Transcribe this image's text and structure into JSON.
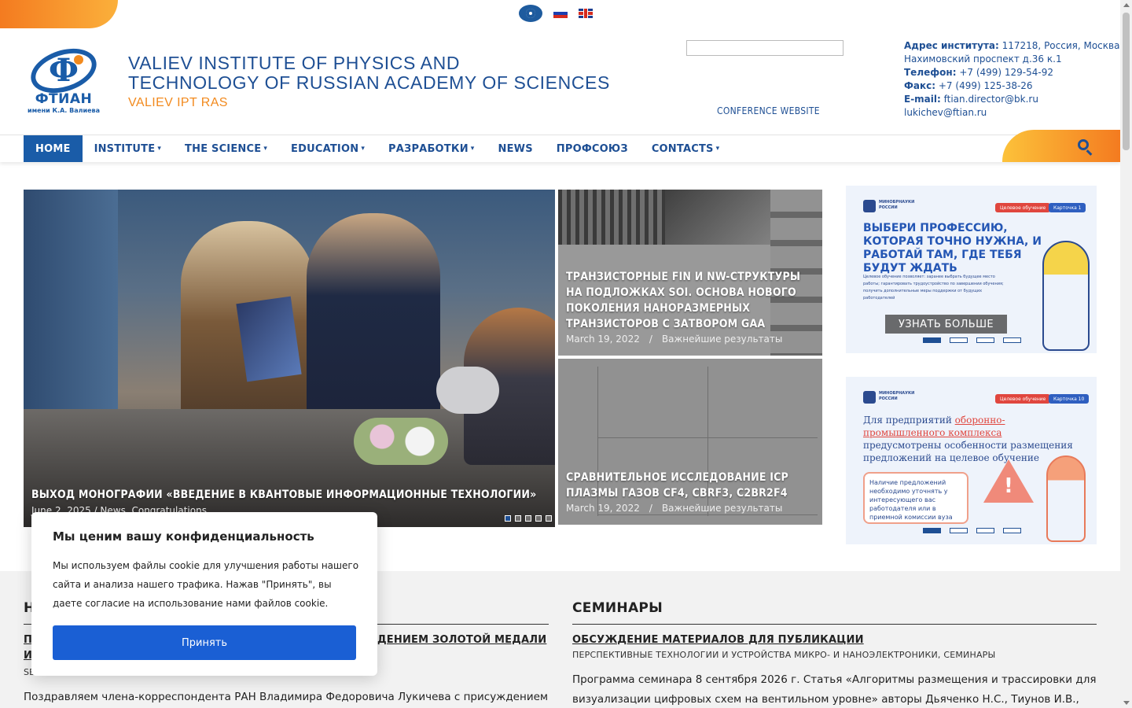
{
  "header": {
    "title_line1": "VALIEV INSTITUTE OF PHYSICS AND",
    "title_line2": "TECHNOLOGY OF RUSSIAN ACADEMY OF SCIENCES",
    "short_title": "VALIEV IPT RAS",
    "logo_name": "ФТИАН",
    "logo_sub": "имени К.А. Валиева",
    "conference_link": "CONFERENCE WEBSITE"
  },
  "contacts": {
    "address_label": "Адрес института:",
    "address_value": " 117218, Россия, Москва,",
    "address_line2": "Нахимовский проспект д.36 к.1",
    "phone_label": "Телефон:",
    "phone_value": " +7 (499) 129-54-92",
    "fax_label": "Факс:",
    "fax_value": " +7 (499) 125-38-26",
    "email_label": "E-mail:",
    "email_value": " ftian.director@bk.ru",
    "email_value2": "lukichev@ftian.ru"
  },
  "nav": [
    {
      "label": "HOME"
    },
    {
      "label": "INSTITUTE"
    },
    {
      "label": "THE SCIENCE"
    },
    {
      "label": "EDUCATION"
    },
    {
      "label": "РАЗРАБОТКИ"
    },
    {
      "label": "NEWS"
    },
    {
      "label": "ПРОФСОЮЗ"
    },
    {
      "label": "CONTACTS"
    }
  ],
  "hero": {
    "main_caption": "ВЫХОД МОНОГРАФИИ «ВВЕДЕНИЕ В КВАНТОВЫЕ ИНФОРМАЦИОННЫЕ ТЕХНОЛОГИИ»",
    "main_meta": "June 2, 2025   /   News, Congratulations",
    "tile1_caption": "ТРАНЗИСТОРНЫЕ FIN И NW-СТРУКТУРЫ НА ПОДЛОЖКАХ SOI. ОСНОВА НОВОГО ПОКОЛЕНИЯ НАНОРАЗМЕРНЫХ ТРАНЗИСТОРОВ С ЗАТВОРОМ GAA",
    "tile1_date": "March 19, 2022",
    "tile1_cat": "Важнейшие результаты",
    "tile2_caption": "СРАВНИТЕЛЬНОЕ ИССЛЕДОВАНИЕ ICP ПЛАЗМЫ ГАЗОВ CF4, CBRF3, C2BR2F4",
    "tile2_date": "March 19, 2022",
    "tile2_cat": "Важнейшие результаты"
  },
  "banner1": {
    "ministry": "МИНОБРНАУКИ РОССИИ",
    "tag1": "Целевое обучение",
    "tag2": "Карточка 1",
    "headline": "ВЫБЕРИ ПРОФЕССИЮ, КОТОРАЯ ТОЧНО НУЖНА, И РАБОТАЙ ТАМ, ГДЕ ТЕБЯ БУДУТ ЖДАТЬ",
    "list": "Целевое обучение позволяет: заранее выбрать будущее место работы; гарантировать трудоустройство по завершении обучения; получить дополнительные меры поддержки от будущих работодателей",
    "button": "УЗНАТЬ БОЛЬШЕ"
  },
  "banner2": {
    "ministry": "МИНОБРНАУКИ РОССИИ",
    "tag1": "Целевое обучение",
    "tag2": "Карточка 10",
    "head_a": "Для предприятий ",
    "head_hl": "оборонно-промышленного комплекса",
    "head_b": " предусмотрены особенности размещения предложений на целевое обучение",
    "box": "Наличие предложений необходимо уточнять у интересующего вас работодателя или в приемной комиссии вуза"
  },
  "news_col": {
    "title_fragment": "Н",
    "post_title_line1": "П",
    "post_title_right": "ДЕНИЕМ ЗОЛОТОЙ МЕДАЛИ",
    "post_title_line2": "И",
    "meta_fragment": "SE",
    "text": "Поздравляем члена-корреспондента РАН Владимира Федоровича Лукичева с присуждением"
  },
  "seminars_col": {
    "title": "СЕМИНАРЫ",
    "post_title": "ОБСУЖДЕНИЕ МАТЕРИАЛОВ ДЛЯ ПУБЛИКАЦИИ",
    "post_cat": "ПЕРСПЕКТИВНЫЕ ТЕХНОЛОГИИ И УСТРОЙСТВА МИКРО- И НАНОЭЛЕКТРОНИКИ, СЕМИНАРЫ",
    "text_line1": "Программа семинара 8 сентября 2026 г. Статья «Алгоритмы размещения и трассировки для",
    "text_line2": "визуализации цифровых схем на вентильном уровне» авторы Дьяченко Н.С., Тиунов И.В., Гаврилов"
  },
  "cookie": {
    "title": "Мы ценим вашу конфиденциальность",
    "text": "Мы используем файлы cookie для улучшения работы нашего сайта и анализа нашего трафика. Нажав \"Принять\", вы даете согласие на использование нами файлов cookie.",
    "accept": "Принять"
  },
  "colors": {
    "brand_blue": "#1a5ca8",
    "accent_orange": "#f28a1e",
    "cookie_button": "#1a5fd4"
  },
  "icons": [
    "accessibility-eye-icon",
    "flag-ru-icon",
    "flag-en-icon",
    "search-icon",
    "chevron-down-icon"
  ]
}
